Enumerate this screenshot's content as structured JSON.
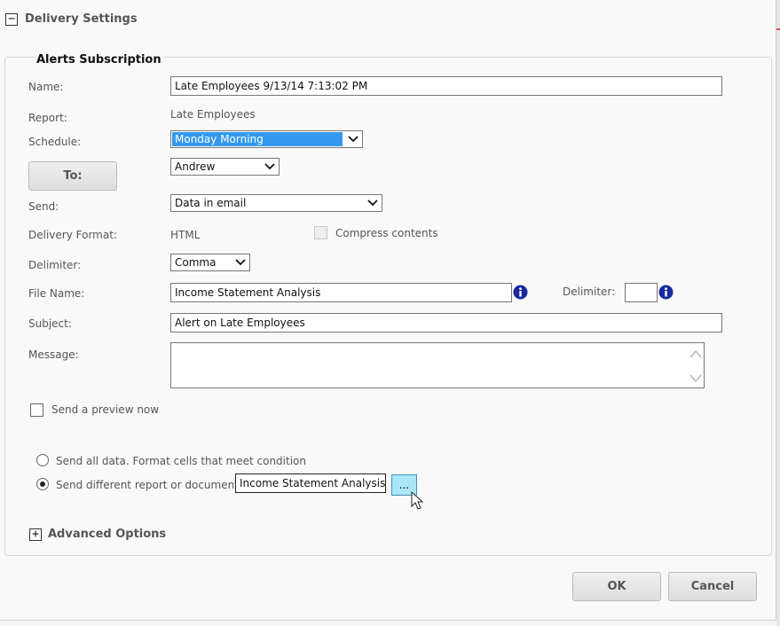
{
  "delivery": {
    "title": "Delivery Settings",
    "collapse_symbol": "−"
  },
  "alerts": {
    "legend": "Alerts Subscription",
    "name_label": "Name:",
    "name_value": "Late Employees 9/13/14 7:13:02 PM",
    "report_label": "Report:",
    "report_value": "Late Employees",
    "schedule_label": "Schedule:",
    "schedule_value": "Monday Morning",
    "to_button": "To:",
    "to_value": "Andrew",
    "send_label": "Send:",
    "send_value": "Data in email",
    "delivery_format_label": "Delivery Format:",
    "delivery_format_value": "HTML",
    "compress_label": "Compress contents",
    "delimiter_label": "Delimiter:",
    "delimiter_value": "Comma",
    "file_name_label": "File Name:",
    "file_name_value": "Income Statement Analysis",
    "file_delimiter_label": "Delimiter:",
    "file_delimiter_value": "",
    "subject_label": "Subject:",
    "subject_value": "Alert on Late Employees",
    "message_label": "Message:",
    "message_value": "",
    "preview_label": "Send a preview now",
    "radio_all_label": "Send all data. Format cells that meet condition",
    "radio_diff_label": "Send different report or document",
    "different_report_value": "Income Statement Analysis",
    "browse_button": "..."
  },
  "advanced": {
    "title": "Advanced Options",
    "expand_symbol": "+"
  },
  "footer": {
    "ok": "OK",
    "cancel": "Cancel"
  },
  "colors": {
    "selection": "#3399ee",
    "info_icon": "#1a2a9c",
    "browse_bg": "#a9e7f7"
  }
}
